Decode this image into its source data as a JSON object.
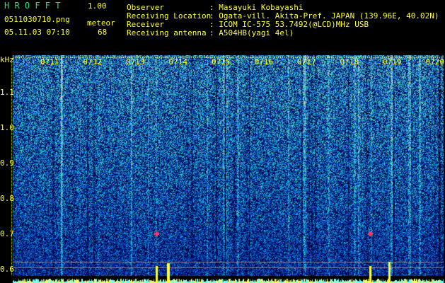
{
  "header": {
    "title": "H R O F F T",
    "version": "1.00",
    "filename": "0511030710.png",
    "datetime": "05.11.03 07:10",
    "meteor_label": "meteor",
    "meteor_count": "68",
    "observer_label": "Observer",
    "observer_value": ": Masayuki Kobayashi",
    "location_label": "Receiving Location",
    "location_value": ": Ogata-vill. Akita-Pref. JAPAN (139.96E, 40.02N)",
    "receiver_label": "Receiver",
    "receiver_value": ": ICOM IC-575 53.7492(@LCD)MHz USB",
    "antenna_label": "Receiving antenna",
    "antenna_value": ": A504HB(yagi 4el)"
  },
  "colors": {
    "label": "#ffff33",
    "title": "#22e07a",
    "background": "#000000",
    "spectrogram_low": "#0a1a80",
    "spectrogram_high": "#33ddaa"
  },
  "chart_data": {
    "type": "heatmap",
    "ylabel": "kHz",
    "y_ticks": [
      "1.1",
      "1.0",
      "0.9",
      "0.8",
      "0.7",
      "0.6"
    ],
    "x_ticks": [
      "0711",
      "0712",
      "0713",
      "0714",
      "0715",
      "0716",
      "0717",
      "0718",
      "0719",
      "0720"
    ],
    "meteor_marks": [
      {
        "time": "0714",
        "freq_khz": 0.7
      },
      {
        "time": "0719",
        "freq_khz": 0.7
      }
    ]
  }
}
